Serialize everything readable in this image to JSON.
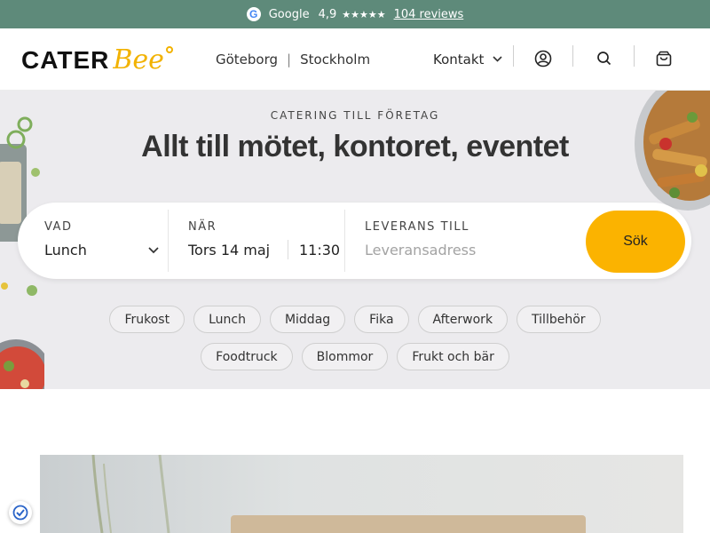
{
  "topbar": {
    "provider": "Google",
    "rating": "4,9",
    "stars": "★★★★★",
    "reviews": "104 reviews"
  },
  "header": {
    "logo_cater": "CATER",
    "logo_bee": "Bee",
    "cities": [
      "Göteborg",
      "Stockholm"
    ],
    "contact": "Kontakt",
    "icons": [
      "user-icon",
      "search-icon",
      "cart-icon"
    ]
  },
  "hero": {
    "eyebrow": "CATERING TILL FÖRETAG",
    "title": "Allt till mötet, kontoret, eventet",
    "background": "#ecebee"
  },
  "search": {
    "what_label": "VAD",
    "what_value": "Lunch",
    "when_label": "NÄR",
    "when_date": "Tors 14 maj",
    "when_time": "11:30",
    "delivery_label": "LEVERANS TILL",
    "delivery_placeholder": "Leveransadress",
    "button": "Sök",
    "button_color": "#fbb300"
  },
  "categories": {
    "row1": [
      "Frukost",
      "Lunch",
      "Middag",
      "Fika",
      "Afterwork",
      "Tillbehör"
    ],
    "row2": [
      "Foodtruck",
      "Blommor",
      "Frukt och bär"
    ]
  },
  "colors": {
    "topbar": "#5e8a7a",
    "accent": "#f2b200"
  }
}
